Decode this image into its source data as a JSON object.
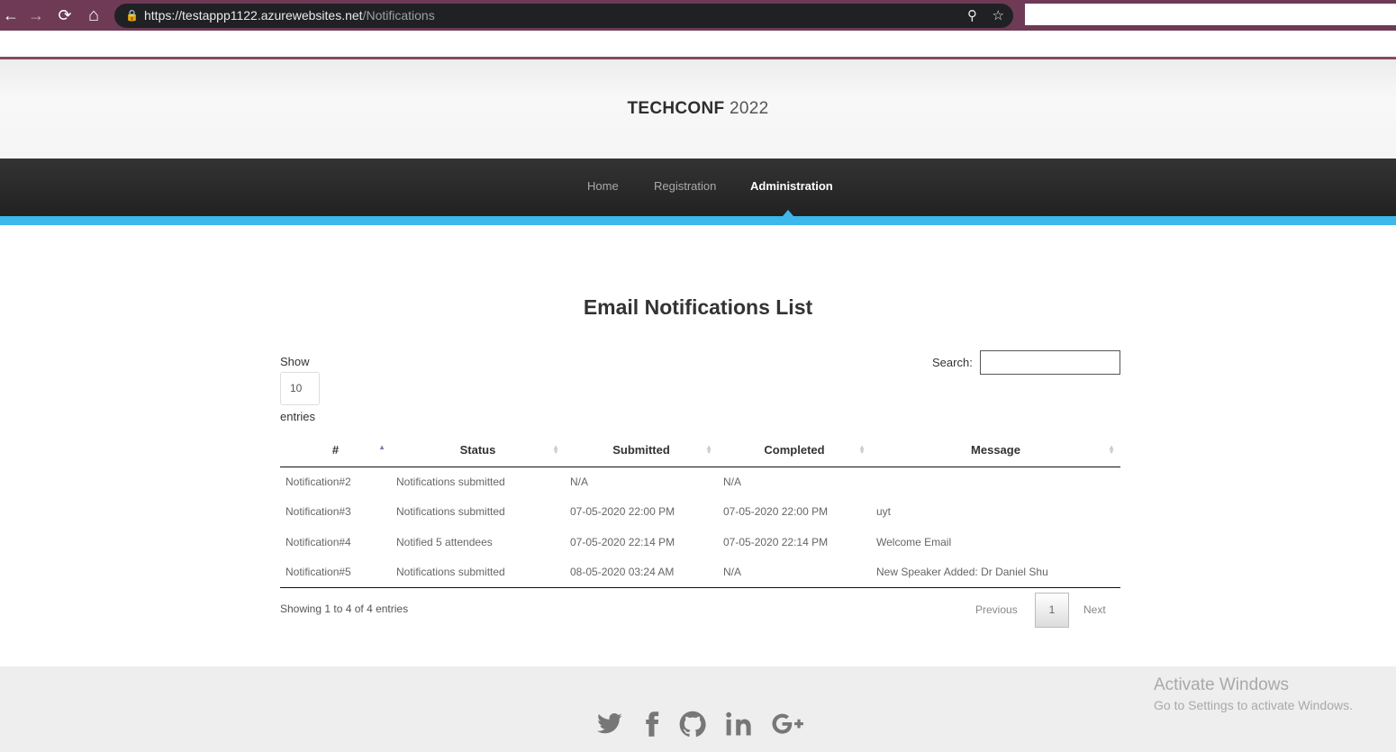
{
  "browser": {
    "url_host": "https://testappp1122.azurewebsites.net",
    "url_path": "/Notifications",
    "back_icon": "←",
    "forward_icon": "→",
    "reload_icon": "⟳",
    "home_icon": "⌂"
  },
  "site": {
    "title_bold": "TECHCONF",
    "title_year": "2022"
  },
  "nav": {
    "items": [
      {
        "label": "Home"
      },
      {
        "label": "Registration"
      },
      {
        "label": "Administration",
        "active": true
      }
    ]
  },
  "page": {
    "title": "Email Notifications List"
  },
  "length_menu": {
    "show_label": "Show",
    "value": "10",
    "entries_label": "entries"
  },
  "search": {
    "label": "Search:",
    "value": ""
  },
  "table": {
    "columns": [
      "#",
      "Status",
      "Submitted",
      "Completed",
      "Message"
    ],
    "rows": [
      [
        "Notification#2",
        "Notifications submitted",
        "N/A",
        "N/A",
        ""
      ],
      [
        "Notification#3",
        "Notifications submitted",
        "07-05-2020 22:00 PM",
        "07-05-2020 22:00 PM",
        "uyt"
      ],
      [
        "Notification#4",
        "Notified 5 attendees",
        "07-05-2020 22:14 PM",
        "07-05-2020 22:14 PM",
        "Welcome Email"
      ],
      [
        "Notification#5",
        "Notifications submitted",
        "08-05-2020 03:24 AM",
        "N/A",
        "New Speaker Added: Dr Daniel Shu"
      ]
    ]
  },
  "table_info": "Showing 1 to 4 of 4 entries",
  "pagination": {
    "previous": "Previous",
    "current_page": "1",
    "next": "Next"
  },
  "footer": {
    "social_icons": [
      "twitter-icon",
      "facebook-icon",
      "github-icon",
      "linkedin-icon",
      "google-plus-icon"
    ],
    "icon_color": "#777777"
  },
  "watermark": {
    "line1": "Activate Windows",
    "line2": "Go to Settings to activate Windows."
  },
  "colors": {
    "accent": "#3db8ea",
    "nav_bg": "#2a2a2a",
    "browser_frame": "#6e3a56"
  }
}
